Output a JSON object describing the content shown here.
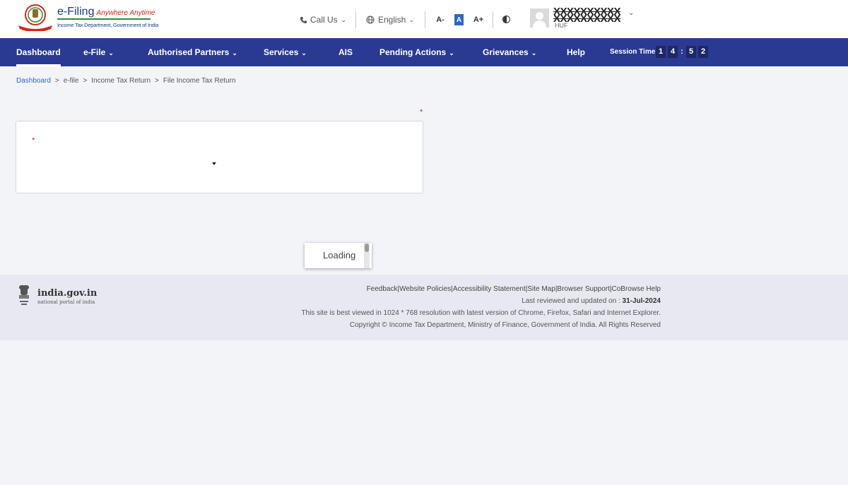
{
  "header": {
    "logo_title": "e-Filing",
    "logo_tagline": "Anywhere Anytime",
    "logo_subtitle": "Income Tax Department, Government of India",
    "call_us": "Call Us",
    "language": "English",
    "font_decrease": "A-",
    "font_normal": "A",
    "font_increase": "A+",
    "user_name": "XXXXXXXXXX",
    "user_name_line2": "XXXXXXXXXX",
    "user_role": "HUF"
  },
  "nav": {
    "items": [
      {
        "label": "Dashboard"
      },
      {
        "label": "e-File"
      },
      {
        "label": "Authorised Partners"
      },
      {
        "label": "Services"
      },
      {
        "label": "AIS"
      },
      {
        "label": "Pending Actions"
      },
      {
        "label": "Grievances"
      },
      {
        "label": "Help"
      }
    ],
    "session_label": "Session Time",
    "session_digits": [
      "1",
      "4",
      "5",
      "2"
    ],
    "session_separator": ":"
  },
  "breadcrumb": {
    "items": [
      "Dashboard",
      "e-file",
      "Income Tax Return",
      "File Income Tax Return"
    ],
    "separator": ">"
  },
  "form": {
    "required_mark": "*"
  },
  "loading": {
    "text": "Loading"
  },
  "footer": {
    "portal_name": "india.gov.in",
    "portal_sub": "national portal of india",
    "links": [
      "Feedback",
      "Website Policies",
      "Accessibility Statement",
      "Site Map",
      "Browser Support",
      "CoBrowse Help"
    ],
    "link_separator": "|",
    "review_label": "Last reviewed and updated on : ",
    "review_date": "31-Jul-2024",
    "best_viewed": "This site is best viewed in 1024 * 768 resolution with latest version of Chrome, Firefox, Safari and Internet Explorer.",
    "copyright": "Copyright © Income Tax Department, Ministry of Finance, Government of India. All Rights Reserved"
  },
  "colors": {
    "nav_bg": "#2a3992",
    "accent_blue": "#2f66c9",
    "required_red": "#d9261c",
    "footer_bg": "#e8e9f0"
  }
}
